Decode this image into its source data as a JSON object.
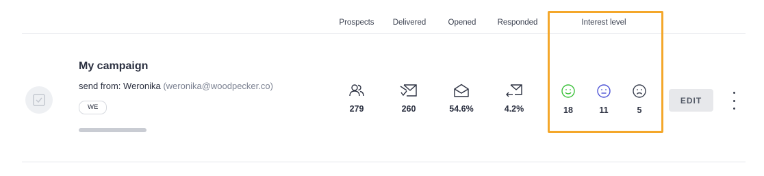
{
  "columns": {
    "prospects": "Prospects",
    "delivered": "Delivered",
    "opened": "Opened",
    "responded": "Responded",
    "interest_level": "Interest level"
  },
  "campaign": {
    "name": "My campaign",
    "sender_prefix": "send from: ",
    "sender_name": "Weronika",
    "sender_email": "(weronika@woodpecker.co)",
    "tag": "WE",
    "progress_fraction": 0.15
  },
  "stats": {
    "prospects": {
      "value": "279",
      "icon": "users-icon"
    },
    "delivered": {
      "value": "260",
      "icon": "mail-delivered-icon"
    },
    "opened": {
      "value": "54.6%",
      "icon": "mail-open-icon"
    },
    "responded": {
      "value": "4.2%",
      "icon": "mail-reply-icon"
    }
  },
  "interest": {
    "positive": {
      "value": "18",
      "icon": "smile-face-icon",
      "color": "#3cc13b"
    },
    "neutral": {
      "value": "11",
      "icon": "neutral-face-icon",
      "color": "#4f55d6"
    },
    "negative": {
      "value": "5",
      "icon": "sad-face-icon",
      "color": "#3b4150"
    }
  },
  "actions": {
    "edit_label": "EDIT",
    "more_icon": "more-vertical-icon"
  },
  "colors": {
    "highlight": "#f4a72a",
    "divider": "#e3e5ea"
  }
}
